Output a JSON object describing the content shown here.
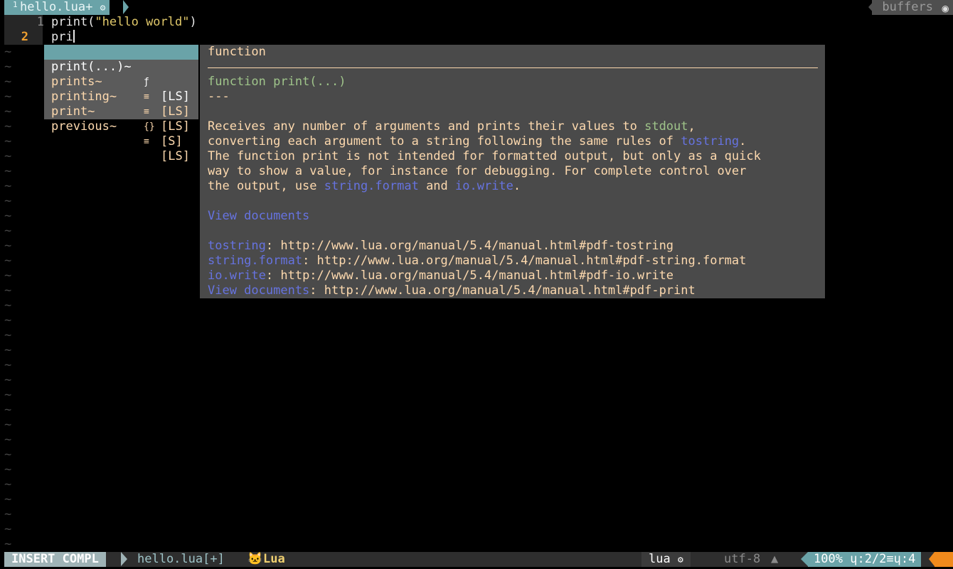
{
  "tabline": {
    "tab_number": "1",
    "tab_label": "hello.lua+ ",
    "tab_icon": "bug-icon",
    "buffers_label": "buffers"
  },
  "editor": {
    "lines": [
      {
        "number": "1",
        "pre": "print(",
        "string": "\"hello world\"",
        "post": ")"
      },
      {
        "number": "2",
        "text": "pri"
      }
    ],
    "tilde": "~"
  },
  "completion_menu": {
    "items": [
      {
        "word": "print(...)~",
        "kind_icon": "ƒ",
        "menu": "[LS]",
        "selected": true
      },
      {
        "word": "prints~",
        "kind_icon": "≡",
        "menu": "[LS]",
        "selected": false
      },
      {
        "word": "printing~",
        "kind_icon": "≡",
        "menu": "[LS]",
        "selected": false
      },
      {
        "word": "print~",
        "kind_icon": "{}",
        "menu": "[S]",
        "selected": false
      },
      {
        "word": "previous~",
        "kind_icon": "≡",
        "menu": "[LS]",
        "selected": false
      }
    ]
  },
  "documentation": {
    "header": "function",
    "signature_kw": "function",
    "signature_rest": " print(...)",
    "separator": "---",
    "p1_a": "Receives any number of arguments and prints their values to ",
    "p1_link": "stdout",
    "p1_b": ",",
    "p2_a": "converting each argument to a string following the same rules of ",
    "p2_link": "tostring",
    "p2_b": ".",
    "p3": "The function print is not intended for formatted output, but only as a quick",
    "p4": "way to show a value, for instance for debugging. For complete control over",
    "p5_a": "the output, use ",
    "p5_link1": "string.format",
    "p5_b": " and ",
    "p5_link2": "io.write",
    "p5_c": ".",
    "view_documents": "View documents",
    "refs": [
      {
        "name": "tostring",
        "url": ": http://www.lua.org/manual/5.4/manual.html#pdf-tostring"
      },
      {
        "name": "string.format",
        "url": ": http://www.lua.org/manual/5.4/manual.html#pdf-string.format"
      },
      {
        "name": "io.write",
        "url": ": http://www.lua.org/manual/5.4/manual.html#pdf-io.write"
      },
      {
        "name": "View documents",
        "url": ": http://www.lua.org/manual/5.4/manual.html#pdf-print"
      }
    ]
  },
  "statusline": {
    "mode": "INSERT COMPL",
    "filename": "hello.lua[+]",
    "filetype_icon": "cat-icon",
    "filetype_name": "Lua",
    "filetype": "lua",
    "encoding": "utf-8",
    "os_icon": "linux-icon",
    "position": "100% ㏑:2/2≡℅:4",
    "percent": "100%",
    "line_info": ":2/2",
    "col_info": ":4"
  },
  "colors": {
    "accent": "#6aa3a8",
    "doc_text": "#fdd9ae",
    "link": "#6673e0",
    "keyword": "#9fc48a",
    "warning": "#f08a1c"
  }
}
